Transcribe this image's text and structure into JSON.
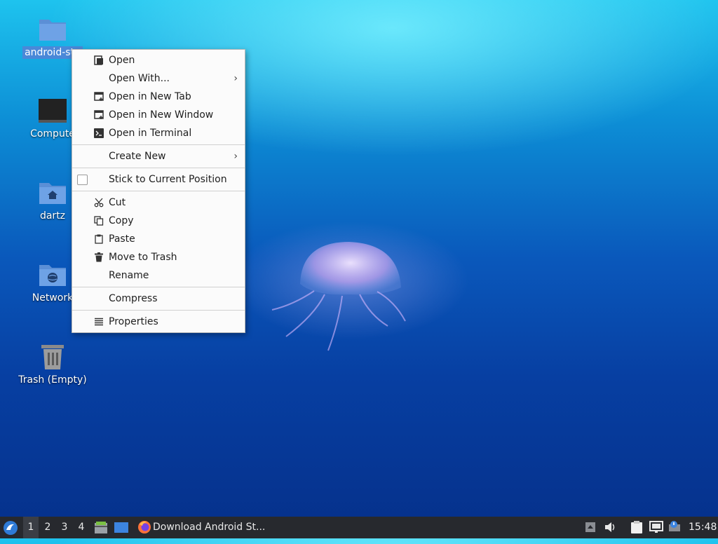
{
  "desktop": {
    "icons": [
      {
        "label": "android-stu",
        "selected": true
      },
      {
        "label": "Compute"
      },
      {
        "label": "dartz"
      },
      {
        "label": "Network"
      },
      {
        "label": "Trash (Empty)"
      }
    ]
  },
  "context_menu": {
    "items": {
      "open": "Open",
      "open_with": "Open With...",
      "open_new_tab": "Open in New Tab",
      "open_new_window": "Open in New Window",
      "open_terminal": "Open in Terminal",
      "create_new": "Create New",
      "stick": "Stick to Current Position",
      "cut": "Cut",
      "copy": "Copy",
      "paste": "Paste",
      "move_trash": "Move to Trash",
      "rename": "Rename",
      "compress": "Compress",
      "properties": "Properties"
    },
    "submenu_arrow": "›"
  },
  "taskbar": {
    "workspaces": [
      "1",
      "2",
      "3",
      "4"
    ],
    "active_workspace": "1",
    "window_title": "Download Android St...",
    "clock": "15:48"
  },
  "colors": {
    "taskbar": "#27292e",
    "selection": "#4a88d8",
    "folder": "#5b8fd6"
  }
}
